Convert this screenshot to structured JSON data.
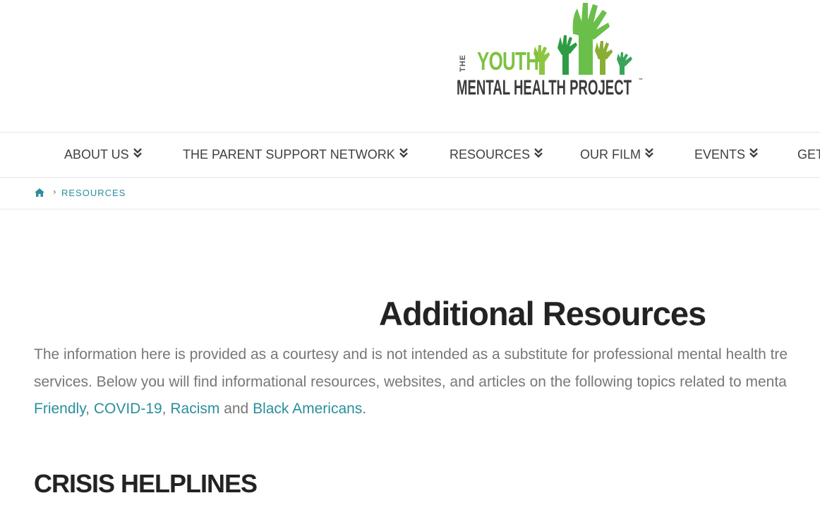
{
  "logo": {
    "the": "THE",
    "youth": "YOUTH",
    "line2": "MENTAL HEALTH PROJECT",
    "tm": "™",
    "colors": {
      "green": "#7dc242",
      "light_green": "#6abf4b",
      "dark_green": "#2e9c45",
      "gray": "#3c3c3c"
    }
  },
  "nav": {
    "items": [
      {
        "label": "ABOUT US"
      },
      {
        "label": "THE PARENT SUPPORT NETWORK"
      },
      {
        "label": "RESOURCES"
      },
      {
        "label": "OUR FILM"
      },
      {
        "label": "EVENTS"
      },
      {
        "label": "GET"
      }
    ],
    "chevron_icon": "double-chevron-down-icon"
  },
  "breadcrumb": {
    "home_icon": "home-icon",
    "separator": "›",
    "current": "RESOURCES"
  },
  "page": {
    "title": "Additional Resources",
    "intro": {
      "line1": "The information here is provided as a courtesy and is not intended as a substitute for professional mental health tre",
      "line2": "services. Below you will find informational resources, websites, and articles on the following topics related to menta",
      "links": [
        "Friendly",
        "COVID-19",
        "Racism",
        "Black Americans"
      ],
      "sep1": ", ",
      "sep2": ", ",
      "and_text": " and ",
      "end": "."
    },
    "section_title": "CRISIS HELPLINES"
  },
  "colors": {
    "accent": "#2a8f9c",
    "heading": "#232323",
    "body_text": "#777777",
    "nav_text": "#3f3f3f"
  }
}
